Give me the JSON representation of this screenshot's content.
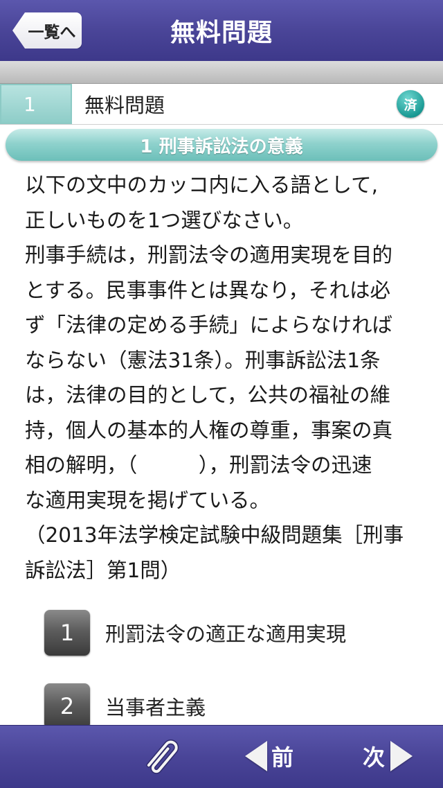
{
  "header": {
    "back_label": "一覧へ",
    "title": "無料問題"
  },
  "question_row": {
    "number": "1",
    "name": "無料問題",
    "done_badge": "済"
  },
  "section": {
    "title": "1 刑事訴訟法の意義"
  },
  "content": {
    "lines": [
      "以下の文中のカッコ内に入る語として,",
      "正しいものを1つ選びなさい。",
      "刑事手続は，刑罰法令の適用実現を目的",
      "とする。民事事件とは異なり，それは必",
      "ず「法律の定める手続」によらなければ",
      "ならない（憲法31条）。刑事訴訟法1条",
      "は，法律の目的として，公共の福祉の維",
      "持，個人の基本的人権の尊重，事案の真",
      "相の解明，（　　　），刑罰法令の迅速",
      "な適用実現を掲げている。",
      "（2013年法学検定試験中級問題集［刑事",
      "訴訟法］第1問）"
    ]
  },
  "choices": [
    {
      "number": "1",
      "text": "刑罰法令の適正な適用実現"
    },
    {
      "number": "2",
      "text": "当事者主義"
    }
  ],
  "footer": {
    "clip_icon": "paperclip-icon",
    "prev_label": "前",
    "next_label": "次"
  },
  "colors": {
    "header_bg": "#4a4598",
    "accent_teal": "#8fd2cd",
    "badge_teal": "#1a9a94",
    "choice_button": "#5d5d5d"
  }
}
